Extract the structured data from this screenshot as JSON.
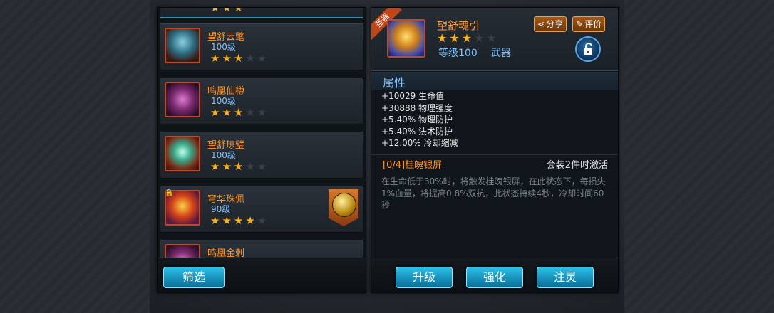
{
  "list": {
    "items": [
      {
        "name": "望舒云氅",
        "level": "100级",
        "stars": 3
      },
      {
        "name": "鸣凰仙樽",
        "level": "100级",
        "stars": 3
      },
      {
        "name": "望舒琼璧",
        "level": "100级",
        "stars": 3
      },
      {
        "name": "穹华珠佩",
        "level": "90级",
        "stars": 4
      },
      {
        "name": "鸣凰金刺"
      }
    ],
    "max_stars": 5
  },
  "filter_button": "筛选",
  "detail": {
    "ribbon": "圣器",
    "name": "望舒魂引",
    "stars": 3,
    "level": "等级100",
    "type": "武器",
    "share_button": "分享",
    "review_button": "评价",
    "section_title": "属性",
    "attributes": [
      "+10029 生命值",
      "+30888 物理强度",
      "+5.40% 物理防护",
      "+5.40% 法术防护",
      "+12.00% 冷却缩减"
    ],
    "set_name": "[0/4]桂魄银屏",
    "set_note": "套装2件时激活",
    "description": "在生命低于30%时，将触发桂魄银屏，在此状态下，每损失1%血量，将提高0.8%双抗，此状态持续4秒，冷却时间60秒"
  },
  "actions": {
    "upgrade": "升级",
    "enhance": "强化",
    "infuse": "注灵"
  },
  "colors": {
    "item_name": "#ff9a2e",
    "level_text": "#7fc3ff",
    "star_on": "#f7b21a",
    "button_blue": "#1a9fd0"
  }
}
